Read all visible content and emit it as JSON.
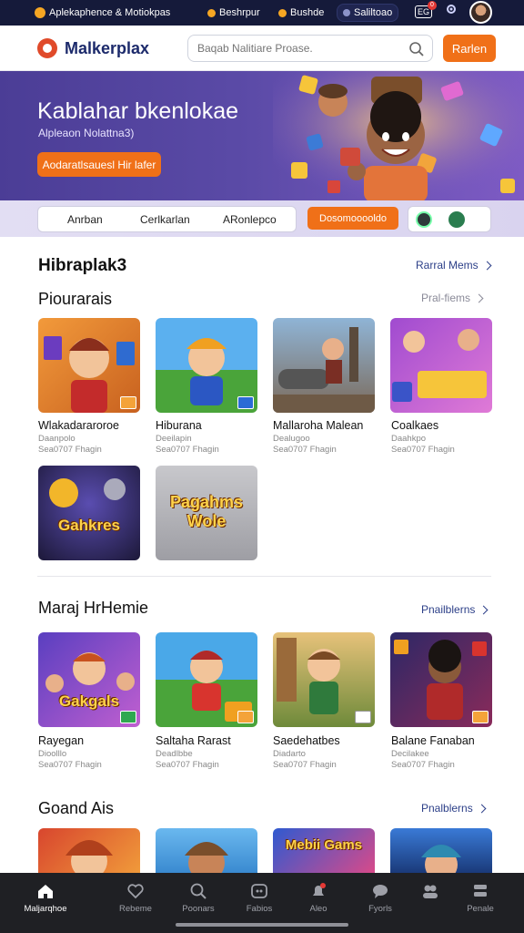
{
  "topbar": {
    "brand": "Aplekaphence & Motiokpas",
    "item1": "Beshrpur",
    "item2": "Bushde",
    "item3": "Saliltoao",
    "badge_count": "0",
    "badge_label": "EG",
    "colors": {
      "bg": "#151a3a",
      "accent": "#f5a623"
    }
  },
  "header": {
    "logo_text": "Malkerplax",
    "search_placeholder": "Baqab Nalitiare Proase.",
    "signin_label": "Rarlen"
  },
  "hero": {
    "title": "Kablahar bkenlokae",
    "subtitle": "Alpleaon Nolattna3)",
    "cta_label": "Aodaratlsauesl Hir lafer"
  },
  "filters": {
    "tabs": [
      "Anrban",
      "Cerlkarlan",
      "ARonlepco"
    ],
    "action_label": "Dosomooooldo"
  },
  "sections": {
    "main_heading": "Hibraplak3",
    "main_link": "Rarral Mems",
    "s1_heading": "Piourarais",
    "s1_link": "Pral-fiems",
    "s1_games": [
      {
        "name": "Wlakadararoroe",
        "dev": "Daanpolo",
        "meta": "Sea0707 Fhagin"
      },
      {
        "name": "Hiburana",
        "dev": "Deeilapin",
        "meta": "Sea0707 Fhagin"
      },
      {
        "name": "Mallaroha Malean",
        "dev": "Dealugoo",
        "meta": "Sea0707 Fhagin"
      },
      {
        "name": "Coalkaes",
        "dev": "Daahkpo",
        "meta": "Sea0707 Fhagin"
      }
    ],
    "s1_extra_titles": [
      "Gahkres",
      "Pagahms Wole"
    ],
    "s2_heading": "Maraj HrHemie",
    "s2_link": "Pnailblerns",
    "s2_games": [
      {
        "name": "Rayegan",
        "dev": "Dioolllo",
        "meta": "Sea0707 Fhagin"
      },
      {
        "name": "Saltaha Rarast",
        "dev": "Deadlbbe",
        "meta": "Sea0707 Fhagin"
      },
      {
        "name": "Saedehatbes",
        "dev": "Diadarto",
        "meta": "Sea0707 Fhagin"
      },
      {
        "name": "Balane Fanaban",
        "dev": "Decilakee",
        "meta": "Sea0707 Fhagin"
      }
    ],
    "s2_tile_titles": [
      "Gakgals"
    ],
    "s3_heading": "Goand Ais",
    "s3_link": "Pnalblerns",
    "s3_tile_titles": [
      "Mebii Gams"
    ]
  },
  "bottom_nav": [
    {
      "label": "Maljarqhoe",
      "icon": "home-icon"
    },
    {
      "label": "Rebeme",
      "icon": "heart-icon"
    },
    {
      "label": "Poonars",
      "icon": "search-icon"
    },
    {
      "label": "Fabios",
      "icon": "controller-icon"
    },
    {
      "label": "Aleo",
      "icon": "bell-icon"
    },
    {
      "label": "Fyorls",
      "icon": "chat-icon"
    },
    {
      "label": "",
      "icon": "people-icon"
    },
    {
      "label": "Penale",
      "icon": "menu-icon"
    }
  ]
}
